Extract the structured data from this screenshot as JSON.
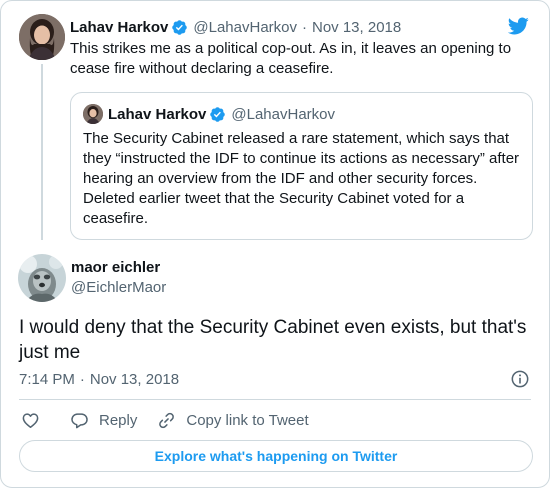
{
  "parent_tweet": {
    "author_name": "Lahav Harkov",
    "author_handle": "@LahavHarkov",
    "separator": "·",
    "date": "Nov 13, 2018",
    "text": "This strikes me as a political cop-out. As in, it leaves an opening to cease fire without declaring a ceasefire."
  },
  "quoted_tweet": {
    "author_name": "Lahav Harkov",
    "author_handle": "@LahavHarkov",
    "text": "The Security Cabinet released a rare statement, which says that they “instructed the IDF to continue its actions as necessary” after hearing an overview from the IDF and other security forces. Deleted earlier tweet that the Security Cabinet voted for a ceasefire."
  },
  "reply_tweet": {
    "author_name": "maor eichler",
    "author_handle": "@EichlerMaor",
    "text": "I would deny that the Security Cabinet even exists, but that's just me",
    "time": "7:14 PM",
    "separator": "·",
    "date": "Nov 13, 2018"
  },
  "actions": {
    "reply_label": "Reply",
    "copy_link_label": "Copy link to Tweet"
  },
  "explore_button": "Explore what's happening on Twitter",
  "colors": {
    "brand_blue": "#1d9bf0",
    "text_primary": "#0f1419",
    "text_secondary": "#536471",
    "border": "#cfd9de"
  },
  "icons": [
    "verified-badge-icon",
    "twitter-bird-icon",
    "info-icon",
    "heart-icon",
    "reply-icon",
    "link-icon"
  ]
}
